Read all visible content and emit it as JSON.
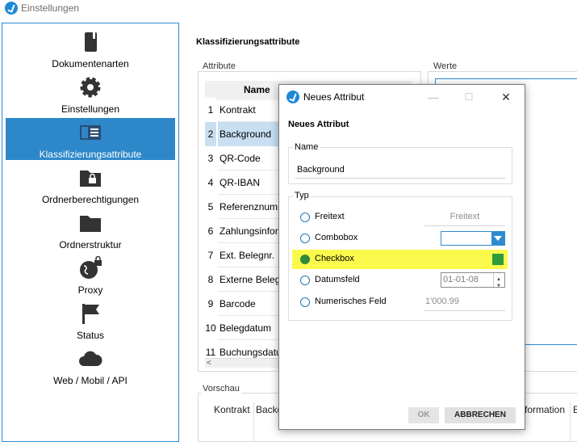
{
  "window": {
    "title": "Einstellungen"
  },
  "sidebar": {
    "items": [
      {
        "label": "Dokumentenarten",
        "icon": "book-icon"
      },
      {
        "label": "Einstellungen",
        "icon": "gear-icon"
      },
      {
        "label": "Klassifizierungsattribute",
        "icon": "list-panel-icon",
        "active": true
      },
      {
        "label": "Ordnerberechtigungen",
        "icon": "folder-lock-icon"
      },
      {
        "label": "Ordnerstruktur",
        "icon": "folder-icon"
      },
      {
        "label": "Proxy",
        "icon": "globe-lock-icon"
      },
      {
        "label": "Status",
        "icon": "flag-icon"
      },
      {
        "label": "Web / Mobil / API",
        "icon": "cloud-icon"
      }
    ]
  },
  "main": {
    "title": "Klassifizierungsattribute",
    "attribute_group": "Attribute",
    "werte_group": "Werte",
    "vorschau_group": "Vorschau",
    "table": {
      "column": "Name",
      "rows": [
        {
          "num": "1",
          "name": "Kontrakt"
        },
        {
          "num": "2",
          "name": "Background",
          "selected": true
        },
        {
          "num": "3",
          "name": "QR-Code"
        },
        {
          "num": "4",
          "name": "QR-IBAN"
        },
        {
          "num": "5",
          "name": "Referenznumm"
        },
        {
          "num": "6",
          "name": "Zahlungsinfor"
        },
        {
          "num": "7",
          "name": "Ext. Belegnr."
        },
        {
          "num": "8",
          "name": "Externe Belegn"
        },
        {
          "num": "9",
          "name": "Barcode"
        },
        {
          "num": "10",
          "name": "Belegdatum"
        },
        {
          "num": "11",
          "name": "Buchungsdatu"
        }
      ]
    },
    "preview_columns": [
      "Kontrakt",
      "Backg",
      "formation",
      "E"
    ]
  },
  "dialog": {
    "title": "Neues Attribut",
    "heading": "Neues Attribut",
    "name_label": "Name",
    "name_value": "Background",
    "typ_label": "Typ",
    "types": [
      {
        "label": "Freitext",
        "placeholder": "Freitext"
      },
      {
        "label": "Combobox"
      },
      {
        "label": "Checkbox",
        "checked": true
      },
      {
        "label": "Datumsfeld",
        "date_value": "01-01-08"
      },
      {
        "label": "Numerisches Feld",
        "placeholder": "1'000.99"
      }
    ],
    "ok_label": "OK",
    "cancel_label": "ABBRECHEN",
    "minimize": "—",
    "maximize": "☐",
    "close": "✕"
  },
  "colors": {
    "accent": "#2e87c9",
    "highlight": "#fbfa4c",
    "check_green": "#2e9b3e"
  }
}
